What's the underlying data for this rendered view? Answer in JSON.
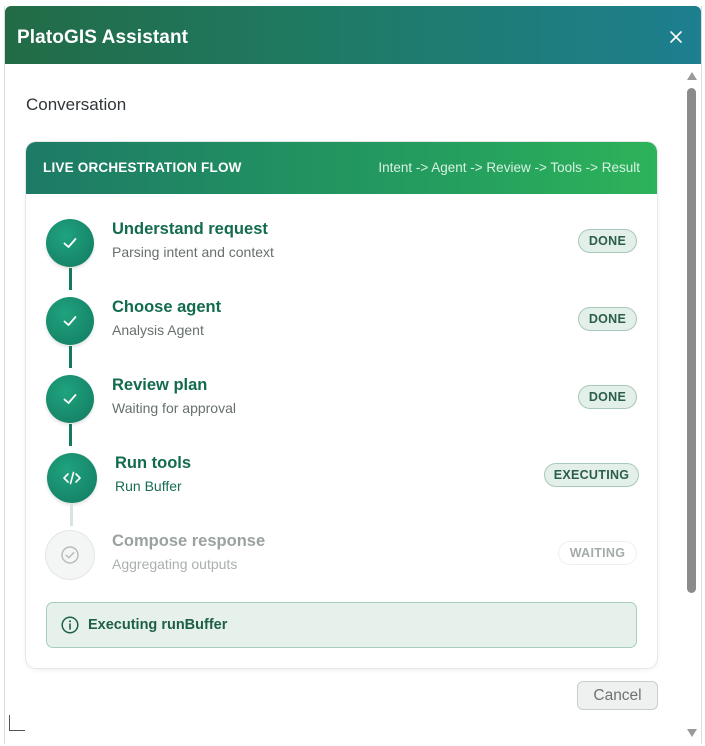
{
  "window": {
    "title": "PlatoGIS Assistant",
    "close_icon": "close-icon"
  },
  "conversation": {
    "heading": "Conversation"
  },
  "flow": {
    "header_title": "LIVE ORCHESTRATION FLOW",
    "header_path": "Intent -> Agent -> Review -> Tools -> Result",
    "steps": [
      {
        "title": "Understand request",
        "subtitle": "Parsing intent and context",
        "status": "DONE",
        "icon": "check-icon"
      },
      {
        "title": "Choose agent",
        "subtitle": "Analysis Agent",
        "status": "DONE",
        "icon": "check-icon"
      },
      {
        "title": "Review plan",
        "subtitle": "Waiting for approval",
        "status": "DONE",
        "icon": "check-icon"
      },
      {
        "title": "Run tools",
        "subtitle": "Run Buffer",
        "status": "EXECUTING",
        "icon": "code-icon"
      },
      {
        "title": "Compose response",
        "subtitle": "Aggregating outputs",
        "status": "WAITING",
        "icon": "check-circle-icon"
      }
    ],
    "status_message": "Executing runBuffer",
    "status_icon": "info-icon"
  },
  "actions": {
    "cancel_label": "Cancel"
  },
  "colors": {
    "brand_dark_green": "#136b4f",
    "accent_green": "#2db35a",
    "title_teal": "#1d7f8f"
  }
}
